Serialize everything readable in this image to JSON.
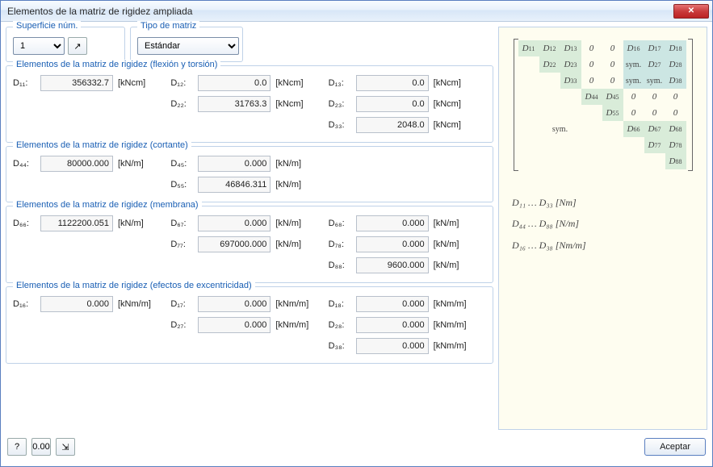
{
  "window": {
    "title": "Elementos de la matriz de rigidez ampliada"
  },
  "top": {
    "surface_label": "Superficie núm.",
    "surface_value": "1",
    "matrix_type_label": "Tipo de matriz",
    "matrix_type_value": "Estándar"
  },
  "sections": {
    "flex": {
      "title": "Elementos de la matriz de rigidez (flexión y torsión)",
      "unit": "[kNcm]",
      "D11": "356332.7",
      "D12": "0.0",
      "D13": "0.0",
      "D22": "31763.3",
      "D23": "0.0",
      "D33": "2048.0"
    },
    "shear": {
      "title": "Elementos de la matriz de rigidez (cortante)",
      "unit": "[kN/m]",
      "D44": "80000.000",
      "D45": "0.000",
      "D55": "46846.311"
    },
    "membrane": {
      "title": "Elementos de la matriz de rigidez (membrana)",
      "unit": "[kN/m]",
      "D66": "1122200.051",
      "D67": "0.000",
      "D68": "0.000",
      "D77": "697000.000",
      "D78": "0.000",
      "D88": "9600.000"
    },
    "ecc": {
      "title": "Elementos de la matriz de rigidez (efectos de excentricidad)",
      "unit": "[kNm/m]",
      "D16": "0.000",
      "D17": "0.000",
      "D18": "0.000",
      "D27": "0.000",
      "D28": "0.000",
      "D38": "0.000"
    }
  },
  "labels": {
    "D11": "D₁₁:",
    "D12": "D₁₂:",
    "D13": "D₁₃:",
    "D22": "D₂₂:",
    "D23": "D₂₃:",
    "D33": "D₃₃:",
    "D44": "D₄₄:",
    "D45": "D₄₅:",
    "D55": "D₅₅:",
    "D66": "D₆₆:",
    "D67": "D₆₇:",
    "D68": "D₆₈:",
    "D77": "D₇₇:",
    "D78": "D₇₈:",
    "D88": "D₈₈:",
    "D16": "D₁₆:",
    "D17": "D₁₇:",
    "D18": "D₁₈:",
    "D27": "D₂₇:",
    "D28": "D₂₈:",
    "D38": "D₃₈:"
  },
  "matrix_preview": {
    "note1": "D₁₁ … D₃₃  [Nm]",
    "note2": "D₄₄ … D₈₈  [N/m]",
    "note3": "D₁₆ … D₃₈  [Nm/m]",
    "sym": "sym."
  },
  "footer": {
    "accept": "Aceptar",
    "icon_help": "?",
    "icon_units": "0.00",
    "icon_export": "⇲"
  }
}
